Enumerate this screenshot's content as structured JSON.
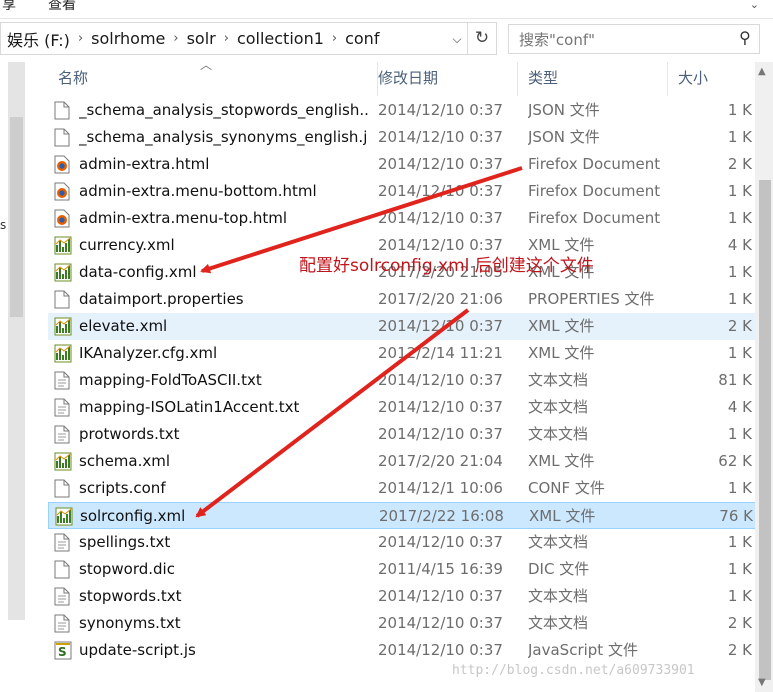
{
  "top": {
    "tab_left": "享",
    "tab_view": "查看"
  },
  "address": {
    "crumbs": [
      "娱乐 (F:)",
      "solrhome",
      "solr",
      "collection1",
      "conf"
    ],
    "dropdown_icon": "chevron-down-icon",
    "refresh_icon": "refresh-icon"
  },
  "search": {
    "placeholder": "搜索\"conf\"",
    "icon": "search-icon"
  },
  "columns": {
    "name": "名称",
    "date": "修改日期",
    "type": "类型",
    "size": "大小"
  },
  "files": [
    {
      "name": "_schema_analysis_stopwords_english....",
      "date": "2014/12/10 0:37",
      "type": "JSON 文件",
      "size": "1 K",
      "icon": "file"
    },
    {
      "name": "_schema_analysis_synonyms_english.j...",
      "date": "2014/12/10 0:37",
      "type": "JSON 文件",
      "size": "1 K",
      "icon": "file"
    },
    {
      "name": "admin-extra.html",
      "date": "2014/12/10 0:37",
      "type": "Firefox Document",
      "size": "2 K",
      "icon": "firefox"
    },
    {
      "name": "admin-extra.menu-bottom.html",
      "date": "2014/12/10 0:37",
      "type": "Firefox Document",
      "size": "1 K",
      "icon": "firefox"
    },
    {
      "name": "admin-extra.menu-top.html",
      "date": "2014/12/10 0:37",
      "type": "Firefox Document",
      "size": "1 K",
      "icon": "firefox"
    },
    {
      "name": "currency.xml",
      "date": "2014/12/10 0:37",
      "type": "XML 文件",
      "size": "4 K",
      "icon": "xml"
    },
    {
      "name": "data-config.xml",
      "date": "2017/2/20 21:05",
      "type": "XML 文件",
      "size": "1 K",
      "icon": "xml"
    },
    {
      "name": "dataimport.properties",
      "date": "2017/2/20 21:06",
      "type": "PROPERTIES 文件",
      "size": "1 K",
      "icon": "file"
    },
    {
      "name": "elevate.xml",
      "date": "2014/12/10 0:37",
      "type": "XML 文件",
      "size": "2 K",
      "icon": "xml",
      "state": "hover"
    },
    {
      "name": "IKAnalyzer.cfg.xml",
      "date": "2012/2/14 11:21",
      "type": "XML 文件",
      "size": "1 K",
      "icon": "xml"
    },
    {
      "name": "mapping-FoldToASCII.txt",
      "date": "2014/12/10 0:37",
      "type": "文本文档",
      "size": "81 K",
      "icon": "txt"
    },
    {
      "name": "mapping-ISOLatin1Accent.txt",
      "date": "2014/12/10 0:37",
      "type": "文本文档",
      "size": "4 K",
      "icon": "txt"
    },
    {
      "name": "protwords.txt",
      "date": "2014/12/10 0:37",
      "type": "文本文档",
      "size": "1 K",
      "icon": "txt"
    },
    {
      "name": "schema.xml",
      "date": "2017/2/20 21:04",
      "type": "XML 文件",
      "size": "62 K",
      "icon": "xml"
    },
    {
      "name": "scripts.conf",
      "date": "2014/12/1 10:06",
      "type": "CONF 文件",
      "size": "1 K",
      "icon": "file"
    },
    {
      "name": "solrconfig.xml",
      "date": "2017/2/22 16:08",
      "type": "XML 文件",
      "size": "76 K",
      "icon": "xml",
      "state": "selected"
    },
    {
      "name": "spellings.txt",
      "date": "2014/12/10 0:37",
      "type": "文本文档",
      "size": "1 K",
      "icon": "txt"
    },
    {
      "name": "stopword.dic",
      "date": "2011/4/15 16:39",
      "type": "DIC 文件",
      "size": "1 K",
      "icon": "file"
    },
    {
      "name": "stopwords.txt",
      "date": "2014/12/10 0:37",
      "type": "文本文档",
      "size": "1 K",
      "icon": "txt"
    },
    {
      "name": "synonyms.txt",
      "date": "2014/12/10 0:37",
      "type": "文本文档",
      "size": "2 K",
      "icon": "txt"
    },
    {
      "name": "update-script.js",
      "date": "2014/12/10 0:37",
      "type": "JavaScript 文件",
      "size": "2 K",
      "icon": "js"
    }
  ],
  "annotation": {
    "text": "配置好solrconfig.xml 后创建这个文件",
    "color": "#c0141b"
  },
  "watermark": "http://blog.csdn.net/a609733901",
  "colors": {
    "selected_bg": "#cce8ff",
    "hover_bg": "#e5f1fb",
    "header_text": "#4c607a"
  }
}
